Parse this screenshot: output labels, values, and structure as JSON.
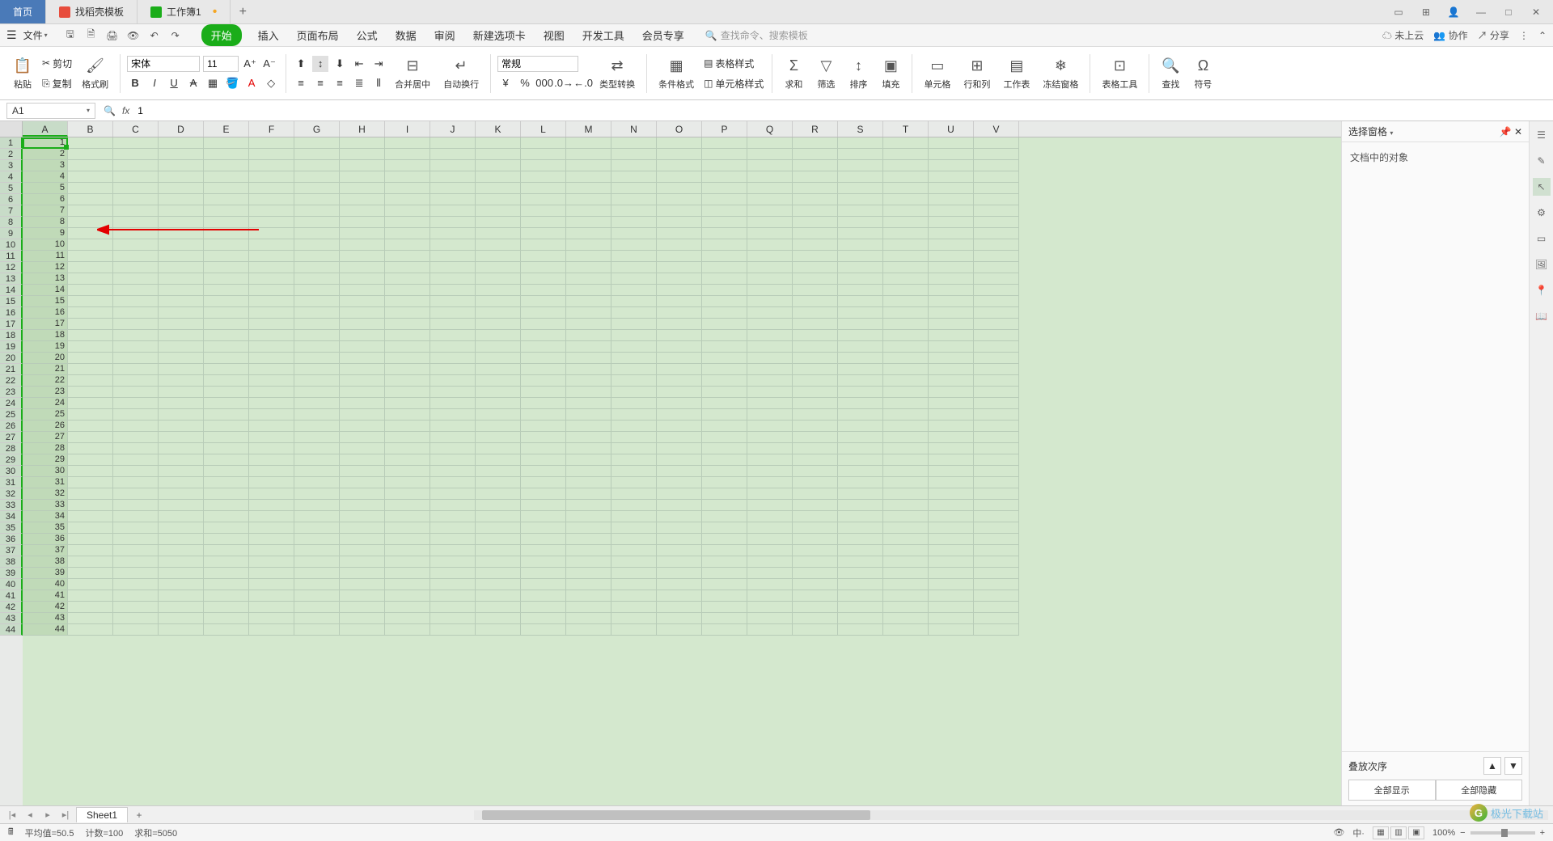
{
  "tabs": {
    "home": "首页",
    "template": "找稻壳模板",
    "workbook": "工作簿1"
  },
  "menu": {
    "file": "文件",
    "tabs": [
      "开始",
      "插入",
      "页面布局",
      "公式",
      "数据",
      "审阅",
      "新建选项卡",
      "视图",
      "开发工具",
      "会员专享"
    ],
    "search_placeholder": "查找命令、搜索模板",
    "cloud": "未上云",
    "collab": "协作",
    "share": "分享"
  },
  "ribbon": {
    "paste": "粘贴",
    "cut": "剪切",
    "copy": "复制",
    "format_painter": "格式刷",
    "font": "宋体",
    "size": "11",
    "merge": "合并居中",
    "wrap": "自动换行",
    "number_format": "常规",
    "type_convert": "类型转换",
    "cond_format": "条件格式",
    "table_style": "表格样式",
    "cell_style": "单元格样式",
    "sum": "求和",
    "filter": "筛选",
    "sort": "排序",
    "fill": "填充",
    "cell": "单元格",
    "rowcol": "行和列",
    "worksheet": "工作表",
    "freeze": "冻结窗格",
    "table_tools": "表格工具",
    "find": "查找",
    "symbol": "符号"
  },
  "namebox": "A1",
  "formula": "1",
  "columns": [
    "A",
    "B",
    "C",
    "D",
    "E",
    "F",
    "G",
    "H",
    "I",
    "J",
    "K",
    "L",
    "M",
    "N",
    "O",
    "P",
    "Q",
    "R",
    "S",
    "T",
    "U",
    "V"
  ],
  "row_count": 44,
  "panel": {
    "title": "选择窗格",
    "objects": "文档中的对象",
    "order": "叠放次序",
    "show_all": "全部显示",
    "hide_all": "全部隐藏"
  },
  "sheet": {
    "name": "Sheet1"
  },
  "status": {
    "avg": "平均值=50.5",
    "count": "计数=100",
    "sum": "求和=5050",
    "zoom": "100%"
  },
  "watermark": "极光下载站"
}
